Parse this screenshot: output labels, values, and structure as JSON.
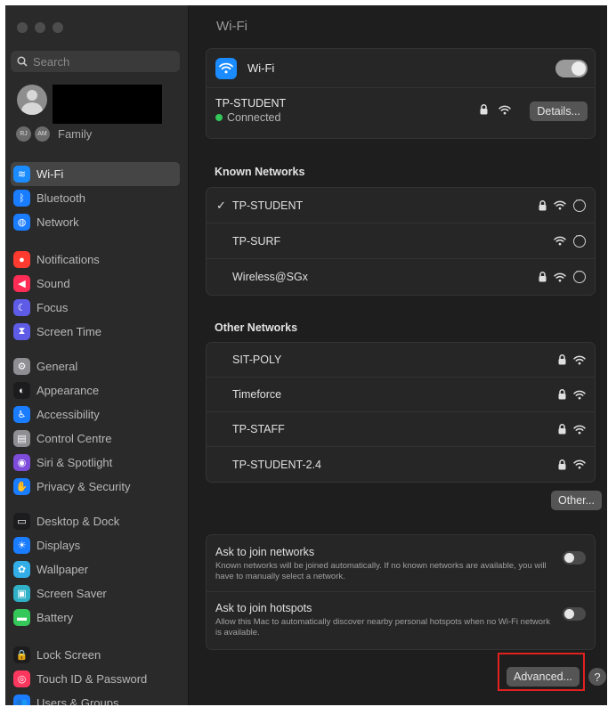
{
  "window_title": "Wi-Fi",
  "sidebar": {
    "search_placeholder": "Search",
    "family_initials": [
      "RJ",
      "AM"
    ],
    "family_label": "Family",
    "groups": [
      [
        {
          "id": "wifi",
          "label": "Wi-Fi",
          "icon": "wifi-icon",
          "color": "#1a8cff",
          "glyph": "≋",
          "active": true
        },
        {
          "id": "bluetooth",
          "label": "Bluetooth",
          "icon": "bluetooth-icon",
          "color": "#1a7cff",
          "glyph": "ᛒ"
        },
        {
          "id": "network",
          "label": "Network",
          "icon": "globe-icon",
          "color": "#1a7cff",
          "glyph": "◍"
        }
      ],
      [
        {
          "id": "notifications",
          "label": "Notifications",
          "icon": "bell-icon",
          "color": "#ff3b30",
          "glyph": "●"
        },
        {
          "id": "sound",
          "label": "Sound",
          "icon": "speaker-icon",
          "color": "#ff2d55",
          "glyph": "◀"
        },
        {
          "id": "focus",
          "label": "Focus",
          "icon": "moon-icon",
          "color": "#5e5ce6",
          "glyph": "☾"
        },
        {
          "id": "screen-time",
          "label": "Screen Time",
          "icon": "hourglass-icon",
          "color": "#5e5ce6",
          "glyph": "⧗"
        }
      ],
      [
        {
          "id": "general",
          "label": "General",
          "icon": "gear-icon",
          "color": "#8e8e93",
          "glyph": "⚙"
        },
        {
          "id": "appearance",
          "label": "Appearance",
          "icon": "appearance-icon",
          "color": "#1c1c1e",
          "glyph": "◐"
        },
        {
          "id": "accessibility",
          "label": "Accessibility",
          "icon": "accessibility-icon",
          "color": "#1a7cff",
          "glyph": "♿"
        },
        {
          "id": "control-centre",
          "label": "Control Centre",
          "icon": "switches-icon",
          "color": "#8e8e93",
          "glyph": "▤"
        },
        {
          "id": "siri",
          "label": "Siri & Spotlight",
          "icon": "siri-icon",
          "color": "#7d4cdb",
          "glyph": "◉"
        },
        {
          "id": "privacy",
          "label": "Privacy & Security",
          "icon": "hand-icon",
          "color": "#1a7cff",
          "glyph": "✋"
        }
      ],
      [
        {
          "id": "desktop-dock",
          "label": "Desktop & Dock",
          "icon": "dock-icon",
          "color": "#1c1c1e",
          "glyph": "▭"
        },
        {
          "id": "displays",
          "label": "Displays",
          "icon": "sun-icon",
          "color": "#1a7cff",
          "glyph": "☀"
        },
        {
          "id": "wallpaper",
          "label": "Wallpaper",
          "icon": "flower-icon",
          "color": "#32ade6",
          "glyph": "✿"
        },
        {
          "id": "screen-saver",
          "label": "Screen Saver",
          "icon": "screensaver-icon",
          "color": "#30b0c7",
          "glyph": "▣"
        },
        {
          "id": "battery",
          "label": "Battery",
          "icon": "battery-icon",
          "color": "#34c759",
          "glyph": "▬"
        }
      ],
      [
        {
          "id": "lock-screen",
          "label": "Lock Screen",
          "icon": "lock-icon",
          "color": "#1c1c1e",
          "glyph": "🔒"
        },
        {
          "id": "touch-id",
          "label": "Touch ID & Password",
          "icon": "fingerprint-icon",
          "color": "#ff375f",
          "glyph": "◎"
        },
        {
          "id": "users-groups",
          "label": "Users & Groups",
          "icon": "users-icon",
          "color": "#1a7cff",
          "glyph": "👥"
        }
      ]
    ]
  },
  "main": {
    "title": "Wi-Fi",
    "wifi_toggle_label": "Wi-Fi",
    "wifi_enabled": true,
    "current_network": {
      "name": "TP-STUDENT",
      "status": "Connected",
      "status_color": "#34c759",
      "details_label": "Details..."
    },
    "known_header": "Known Networks",
    "known_networks": [
      {
        "name": "TP-STUDENT",
        "checked": true,
        "locked": true
      },
      {
        "name": "TP-SURF",
        "checked": false,
        "locked": false
      },
      {
        "name": "Wireless@SGx",
        "checked": false,
        "locked": true
      }
    ],
    "other_header": "Other Networks",
    "other_networks": [
      {
        "name": "SIT-POLY",
        "locked": true
      },
      {
        "name": "Timeforce",
        "locked": true
      },
      {
        "name": "TP-STAFF",
        "locked": true
      },
      {
        "name": "TP-STUDENT-2.4",
        "locked": true
      }
    ],
    "other_button": "Other...",
    "ask_networks": {
      "title": "Ask to join networks",
      "description": "Known networks will be joined automatically. If no known networks are available, you will have to manually select a network.",
      "enabled": false
    },
    "ask_hotspots": {
      "title": "Ask to join hotspots",
      "description": "Allow this Mac to automatically discover nearby personal hotspots when no Wi-Fi network is available.",
      "enabled": false
    },
    "advanced_button": "Advanced...",
    "help_label": "?"
  }
}
